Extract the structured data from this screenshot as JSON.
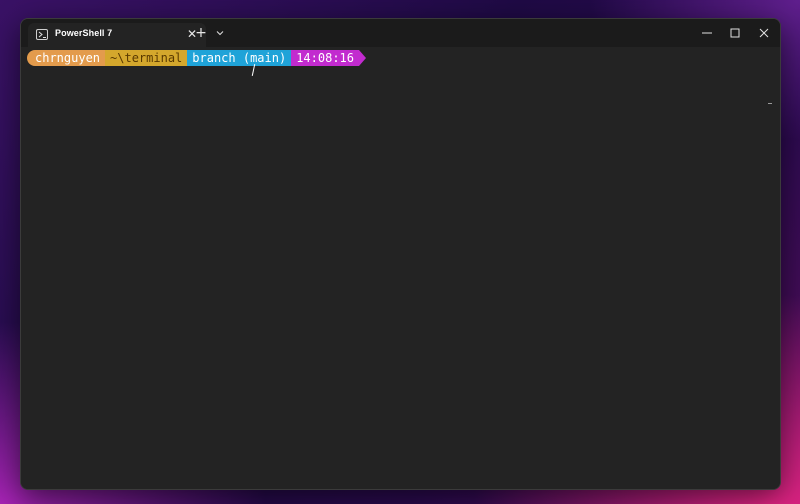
{
  "window": {
    "tab_title": "PowerShell 7",
    "tab_icon": "terminal-icon",
    "close_tab_glyph": "✕",
    "new_tab_glyph": "+",
    "controls": [
      "minimize-icon",
      "maximize-icon",
      "close-icon"
    ]
  },
  "prompt": {
    "user": "chrnguyen",
    "path": "~\\terminal",
    "branch_prefix": "branch (",
    "branch_glyph": "",
    "branch_name": "main)",
    "time": "14:08:16"
  },
  "colors": {
    "user_bg": "#E39B4C",
    "path_bg": "#D4A72C",
    "path_fg": "#5a3a00",
    "branch_bg": "#1FA3D8",
    "time_bg": "#C22BCF",
    "terminal_bg": "#232323",
    "titlebar_bg": "#1B1B1B"
  }
}
